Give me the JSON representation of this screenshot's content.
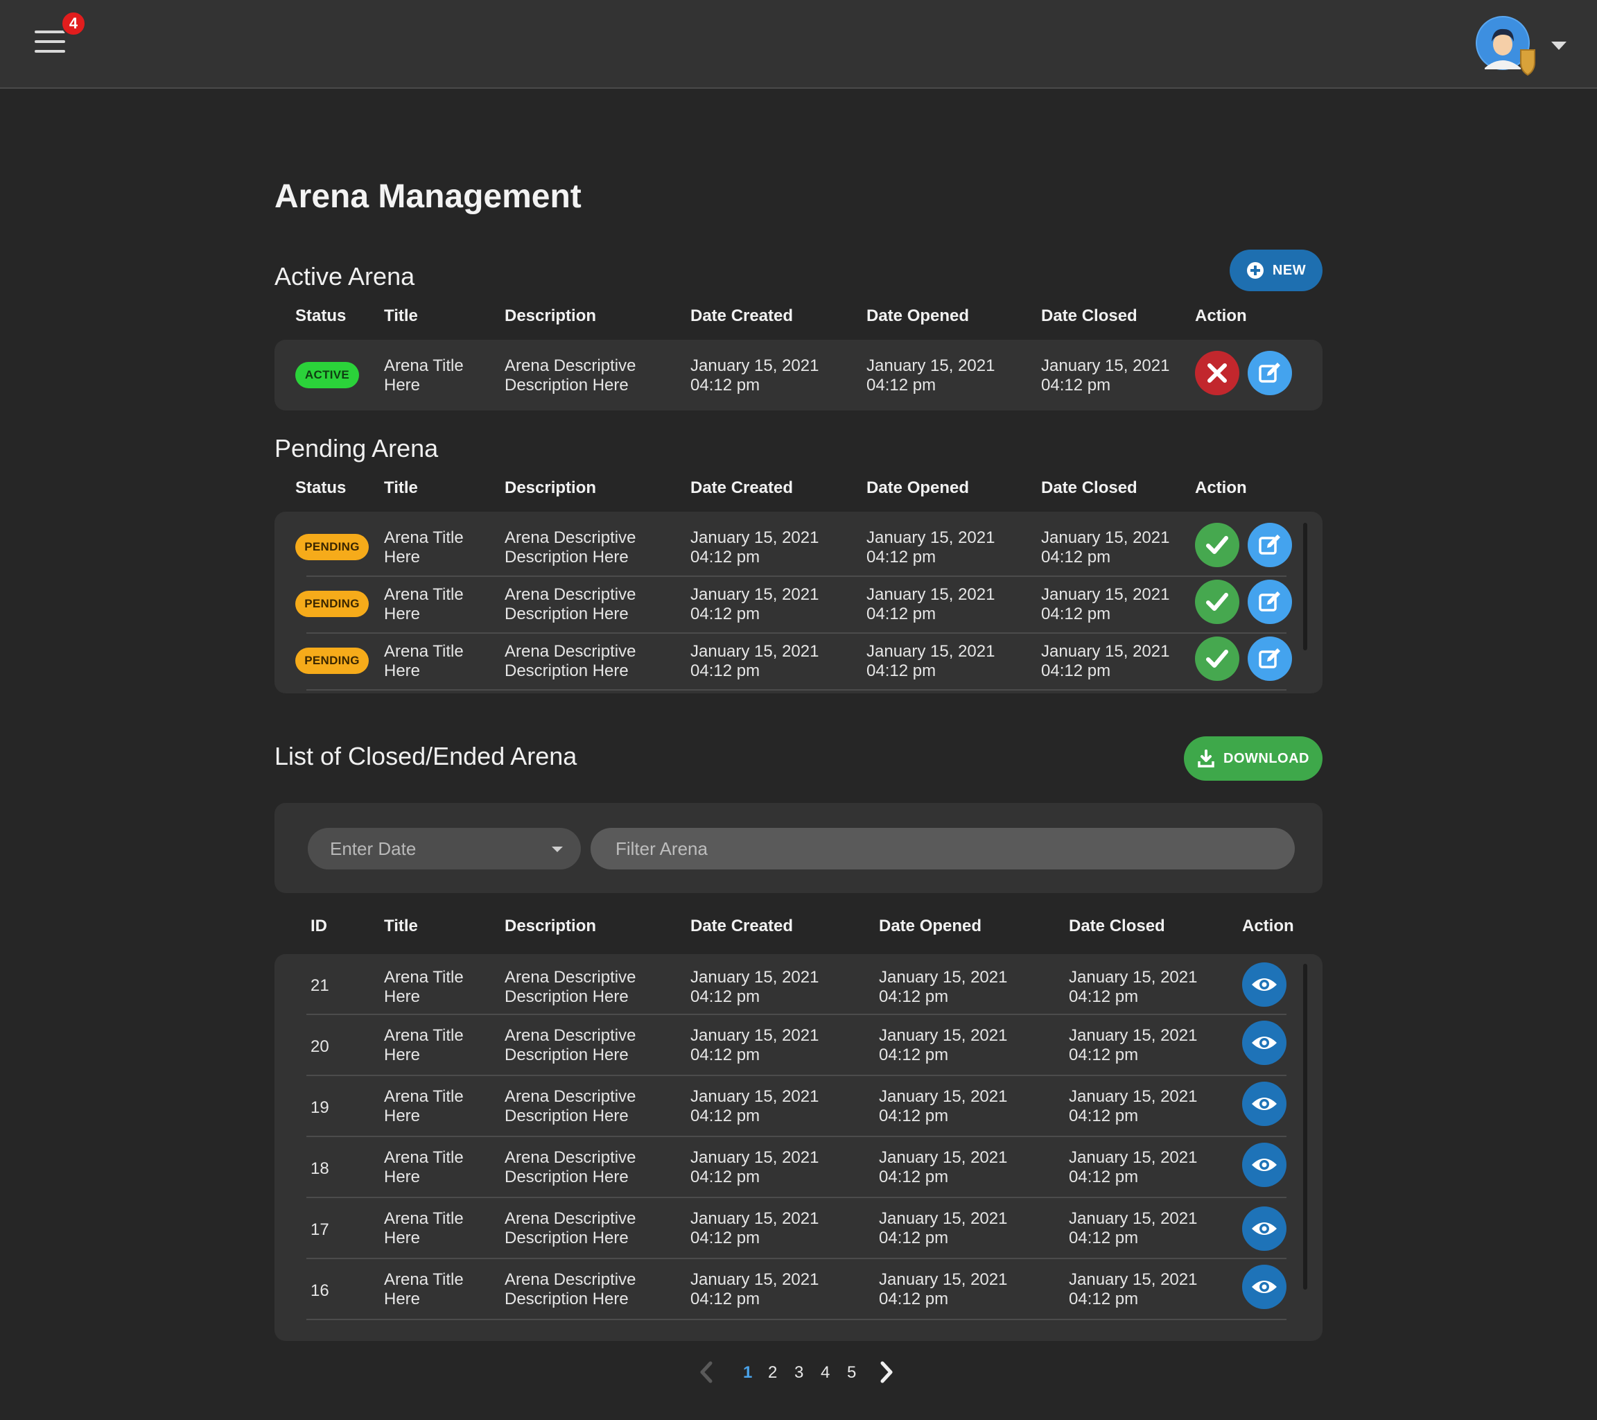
{
  "topbar": {
    "notification_count": "4"
  },
  "page_title": "Arena Management",
  "active": {
    "title": "Active Arena",
    "new_label": "NEW",
    "headers": [
      "Status",
      "Title",
      "Description",
      "Date Created",
      "Date Opened",
      "Date Closed",
      "Action"
    ],
    "rows": [
      {
        "status": "ACTIVE",
        "title1": "Arena Title",
        "title2": "Here",
        "desc1": "Arena Descriptive",
        "desc2": "Description Here",
        "created1": "January 15, 2021",
        "created2": "04:12 pm",
        "opened1": "January 15, 2021",
        "opened2": "04:12 pm",
        "closed1": "January 15, 2021",
        "closed2": "04:12 pm"
      }
    ]
  },
  "pending": {
    "title": "Pending Arena",
    "headers": [
      "Status",
      "Title",
      "Description",
      "Date Created",
      "Date Opened",
      "Date Closed",
      "Action"
    ],
    "rows": [
      {
        "status": "PENDING",
        "title1": "Arena Title",
        "title2": "Here",
        "desc1": "Arena Descriptive",
        "desc2": "Description Here",
        "created1": "January 15, 2021",
        "created2": "04:12 pm",
        "opened1": "January 15, 2021",
        "opened2": "04:12 pm",
        "closed1": "January 15, 2021",
        "closed2": "04:12 pm"
      },
      {
        "status": "PENDING",
        "title1": "Arena Title",
        "title2": "Here",
        "desc1": "Arena Descriptive",
        "desc2": "Description Here",
        "created1": "January 15, 2021",
        "created2": "04:12 pm",
        "opened1": "January 15, 2021",
        "opened2": "04:12 pm",
        "closed1": "January 15, 2021",
        "closed2": "04:12 pm"
      },
      {
        "status": "PENDING",
        "title1": "Arena Title",
        "title2": "Here",
        "desc1": "Arena Descriptive",
        "desc2": "Description Here",
        "created1": "January 15, 2021",
        "created2": "04:12 pm",
        "opened1": "January 15, 2021",
        "opened2": "04:12 pm",
        "closed1": "January 15, 2021",
        "closed2": "04:12 pm"
      }
    ]
  },
  "closed": {
    "title": "List of Closed/Ended Arena",
    "download_label": "DOWNLOAD",
    "date_placeholder": "Enter Date",
    "filter_placeholder": "Filter Arena",
    "headers": [
      "ID",
      "Title",
      "Description",
      "Date Created",
      "Date Opened",
      "Date Closed",
      "Action"
    ],
    "rows": [
      {
        "id": "21",
        "title1": "Arena Title",
        "title2": "Here",
        "desc1": "Arena Descriptive",
        "desc2": "Description Here",
        "created1": "January 15, 2021",
        "created2": "04:12 pm",
        "opened1": "January 15, 2021",
        "opened2": "04:12 pm",
        "closed1": "January 15, 2021",
        "closed2": "04:12 pm"
      },
      {
        "id": "20",
        "title1": "Arena Title",
        "title2": "Here",
        "desc1": "Arena Descriptive",
        "desc2": "Description Here",
        "created1": "January 15, 2021",
        "created2": "04:12 pm",
        "opened1": "January 15, 2021",
        "opened2": "04:12 pm",
        "closed1": "January 15, 2021",
        "closed2": "04:12 pm"
      },
      {
        "id": "19",
        "title1": "Arena Title",
        "title2": "Here",
        "desc1": "Arena Descriptive",
        "desc2": "Description Here",
        "created1": "January 15, 2021",
        "created2": "04:12 pm",
        "opened1": "January 15, 2021",
        "opened2": "04:12 pm",
        "closed1": "January 15, 2021",
        "closed2": "04:12 pm"
      },
      {
        "id": "18",
        "title1": "Arena Title",
        "title2": "Here",
        "desc1": "Arena Descriptive",
        "desc2": "Description Here",
        "created1": "January 15, 2021",
        "created2": "04:12 pm",
        "opened1": "January 15, 2021",
        "opened2": "04:12 pm",
        "closed1": "January 15, 2021",
        "closed2": "04:12 pm"
      },
      {
        "id": "17",
        "title1": "Arena Title",
        "title2": "Here",
        "desc1": "Arena Descriptive",
        "desc2": "Description Here",
        "created1": "January 15, 2021",
        "created2": "04:12 pm",
        "opened1": "January 15, 2021",
        "opened2": "04:12 pm",
        "closed1": "January 15, 2021",
        "closed2": "04:12 pm"
      },
      {
        "id": "16",
        "title1": "Arena Title",
        "title2": "Here",
        "desc1": "Arena Descriptive",
        "desc2": "Description Here",
        "created1": "January 15, 2021",
        "created2": "04:12 pm",
        "opened1": "January 15, 2021",
        "opened2": "04:12 pm",
        "closed1": "January 15, 2021",
        "closed2": "04:12 pm"
      }
    ]
  },
  "pagination": {
    "pages": [
      "1",
      "2",
      "3",
      "4",
      "5"
    ],
    "current": "1"
  },
  "icons": {
    "menu": "hamburger-icon",
    "avatar": "user-avatar",
    "dropdown": "caret-down-icon",
    "new": "plus-circle-icon",
    "download": "download-icon",
    "close": "x-icon",
    "approve": "check-icon",
    "edit": "edit-icon",
    "view": "eye-icon",
    "prev": "chevron-left-icon",
    "next": "chevron-right-icon"
  },
  "colors": {
    "background": "#262626",
    "panel": "#333333",
    "active_badge": "#2bd23a",
    "pending_badge": "#f6ab1a",
    "primary": "#1e6fb0",
    "success": "#3ea84a",
    "danger": "#c2272d",
    "edit": "#44a3ee",
    "notification": "#e11d1d"
  }
}
